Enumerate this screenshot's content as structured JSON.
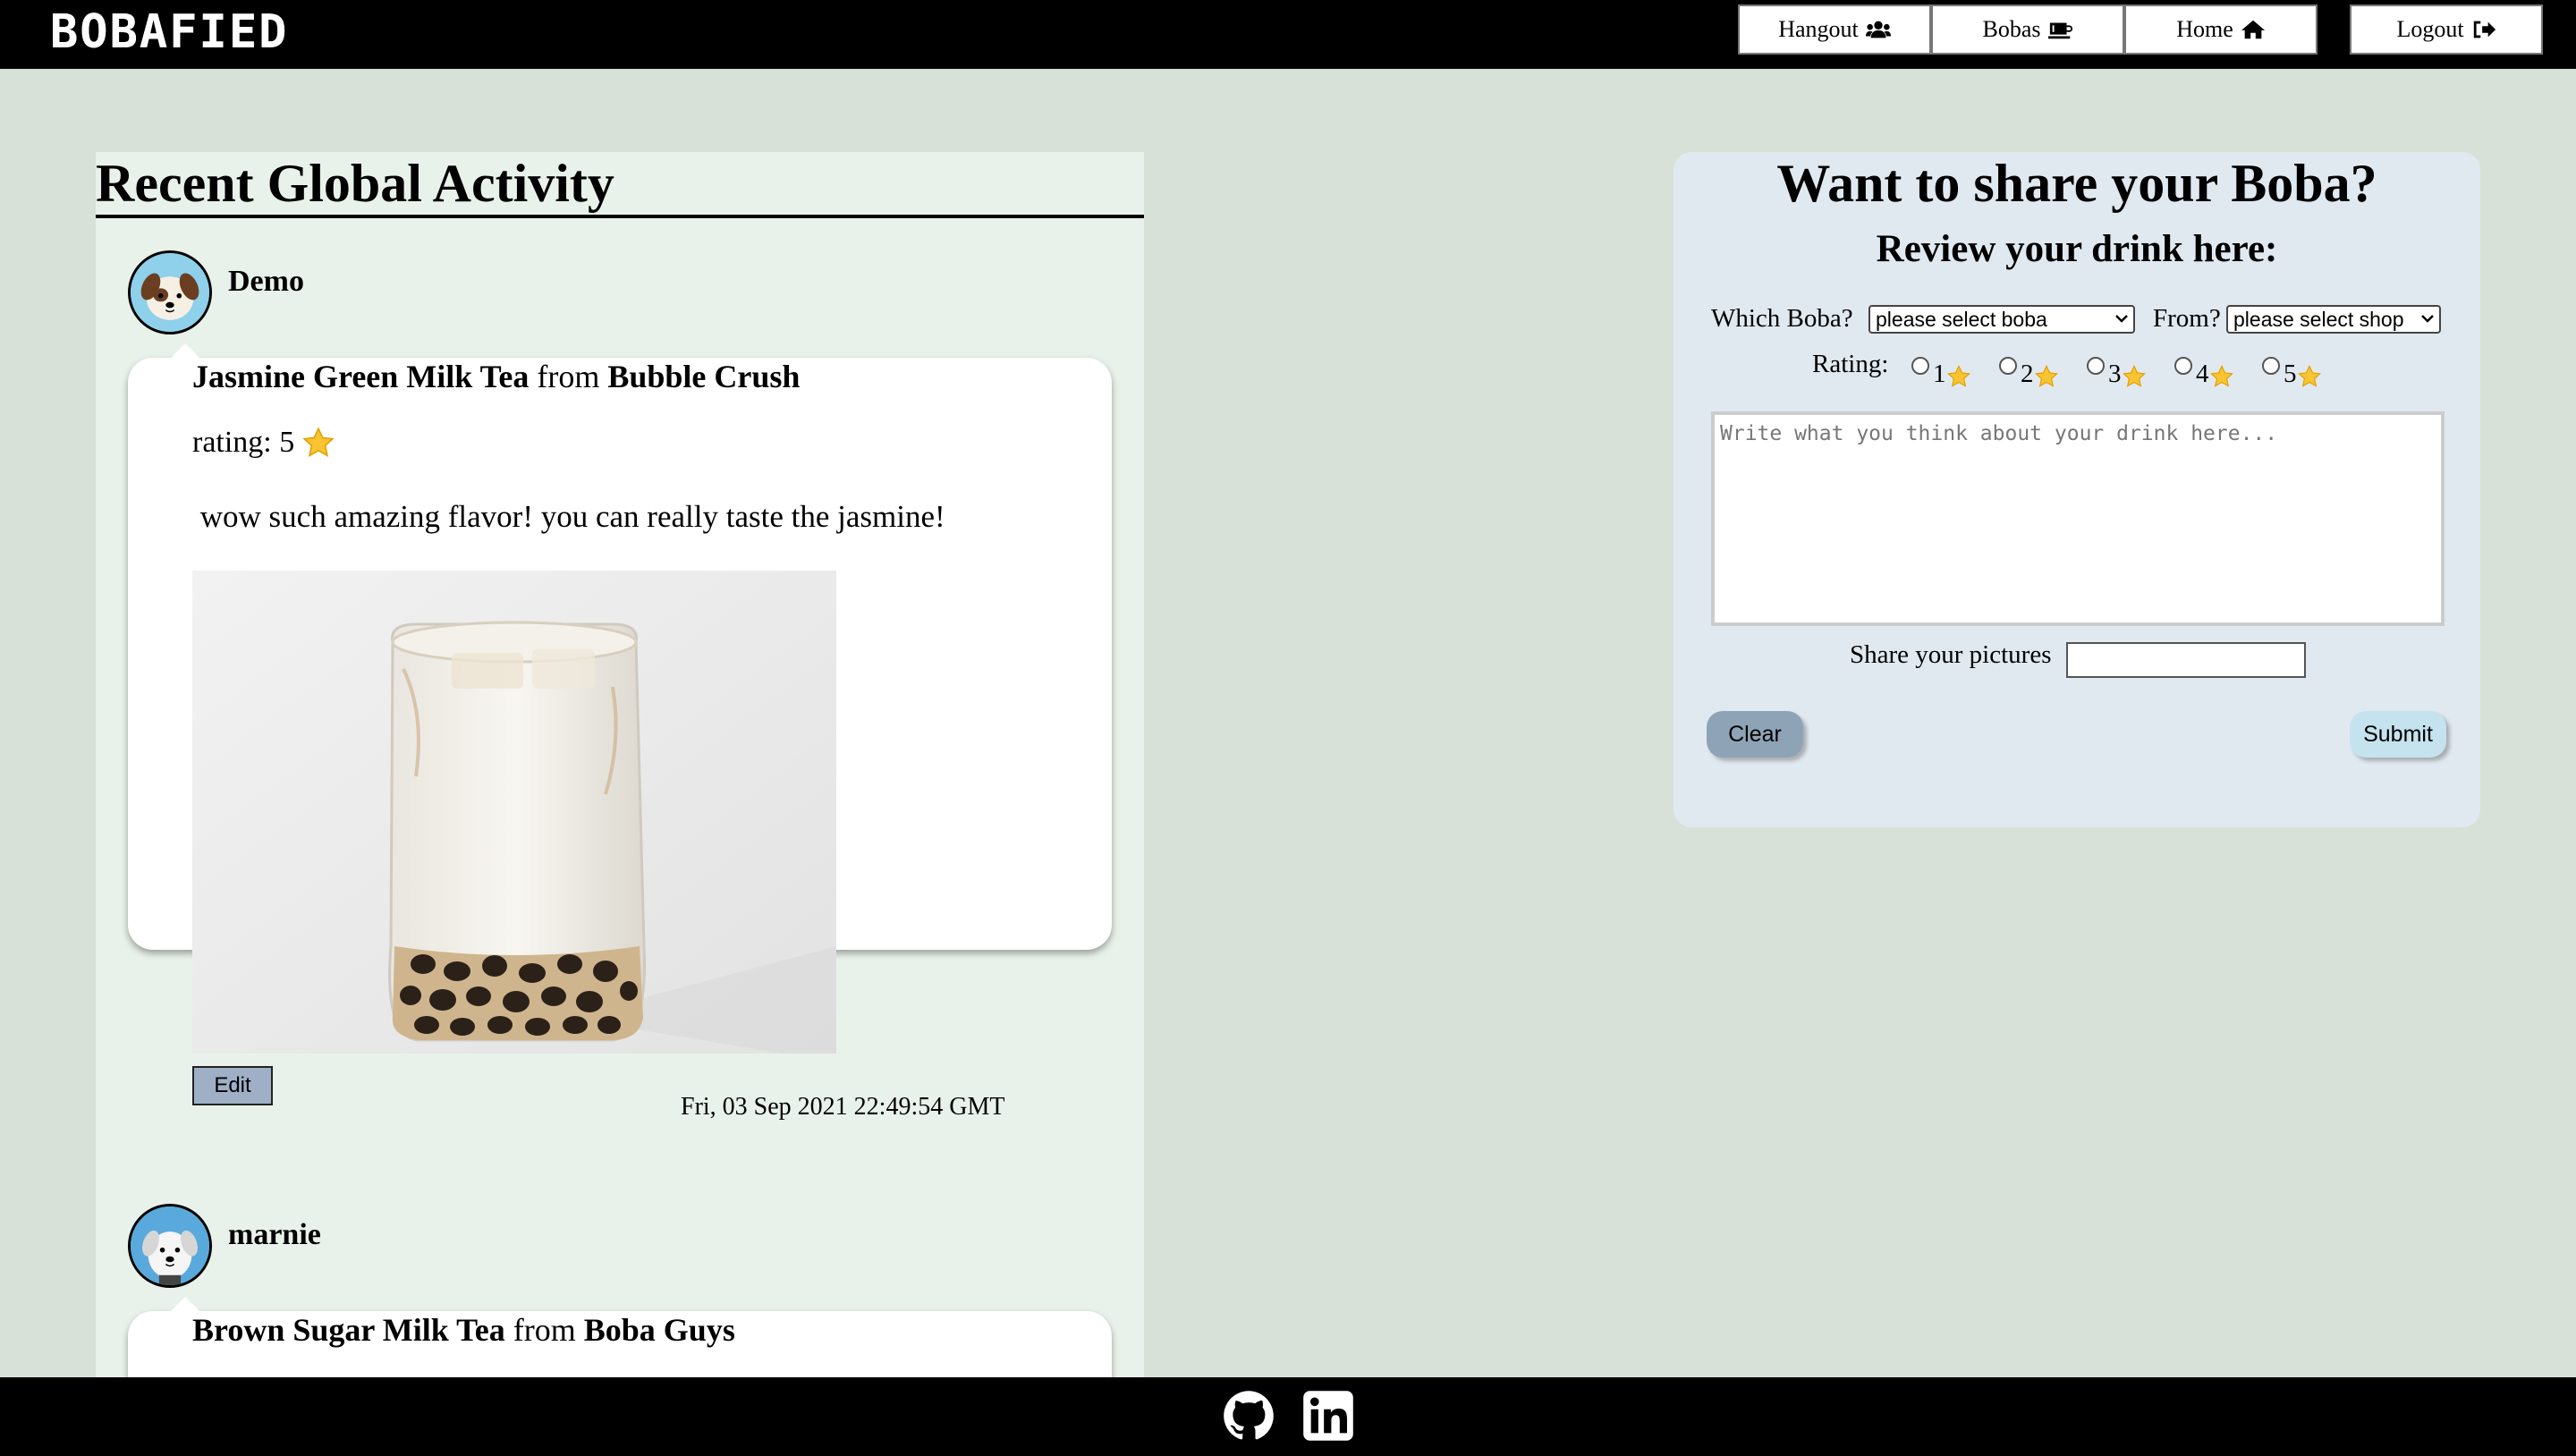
{
  "brand": "BOBAFIED",
  "nav": [
    {
      "label": "Hangout",
      "icon": "users-icon"
    },
    {
      "label": "Bobas",
      "icon": "coffee-icon"
    },
    {
      "label": "Home",
      "icon": "home-icon"
    },
    {
      "label": "Logout",
      "icon": "sign-out-icon"
    }
  ],
  "feed": {
    "title": "Recent Global Activity",
    "posts": [
      {
        "user": "Demo",
        "drink": "Jasmine Green Milk Tea",
        "from_word": "from",
        "shop": "Bubble Crush",
        "rating_label": "rating: 5",
        "review": " wow such amazing flavor! you can really taste the jasmine!",
        "edit_label": "Edit",
        "timestamp": "Fri, 03 Sep 2021 22:49:54 GMT"
      },
      {
        "user": "marnie",
        "drink": "Brown Sugar Milk Tea",
        "from_word": "from",
        "shop": "Boba Guys"
      }
    ]
  },
  "form": {
    "title": "Want to share your Boba?",
    "subtitle": "Review your drink here:",
    "boba_label": "Which Boba?",
    "boba_selected": "please select boba",
    "shop_label": "From?",
    "shop_selected": "please select shop",
    "rating_label": "Rating:",
    "rating_options": [
      "1",
      "2",
      "3",
      "4",
      "5"
    ],
    "textarea_placeholder": "Write what you think about your drink here...",
    "pictures_label": "Share your pictures",
    "clear_label": "Clear",
    "submit_label": "Submit"
  },
  "footer": {
    "icons": [
      "github-icon",
      "linkedin-icon"
    ]
  },
  "colors": {
    "page_bg": "#d7e1d7",
    "feed_bg": "#e9f2ea",
    "form_bg": "#e1e9f0",
    "clear_btn": "#8ea4b6",
    "submit_btn": "#c5e3ee",
    "edit_btn": "#9fb0c6"
  }
}
